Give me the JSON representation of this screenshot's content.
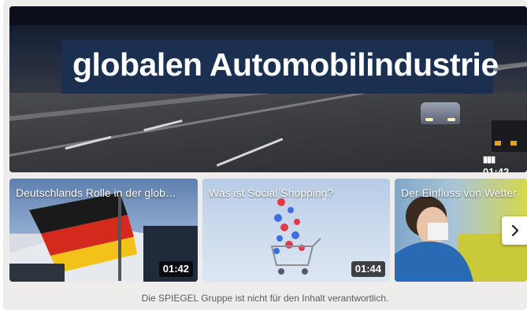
{
  "hero": {
    "headline": "globalen Automobilindustrie",
    "duration": "01:42",
    "duration_icon": "bars-icon"
  },
  "cards": [
    {
      "title": "Deutschlands Rolle in der glob…",
      "duration": "01:42"
    },
    {
      "title": "Was ist Social Shopping?",
      "duration": "01:44"
    },
    {
      "title": "Der Einfluss von Wetter",
      "duration": ""
    }
  ],
  "carousel": {
    "next_icon": "chevron-right-icon"
  },
  "disclaimer": "Die SPIEGEL Gruppe ist nicht für den Inhalt verantwortlich.",
  "colors": {
    "headline_bg": "#1b3050",
    "frame_bg": "#eeedeb",
    "disclaimer_text": "#5c5c5c"
  }
}
